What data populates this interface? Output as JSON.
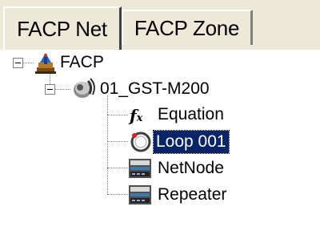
{
  "tabs": [
    {
      "label": "FACP Net",
      "active": true
    },
    {
      "label": "FACP Zone",
      "active": false
    }
  ],
  "tree": {
    "root": {
      "label": "FACP",
      "icon": "network-tower-icon",
      "expanded": true
    },
    "device": {
      "label": "01_GST-M200",
      "icon": "telephone-icon",
      "expanded": true
    },
    "children": [
      {
        "label": "Equation",
        "icon": "function-fx-icon",
        "selected": false
      },
      {
        "label": "Loop 001",
        "icon": "loop-ring-icon",
        "selected": true
      },
      {
        "label": "NetNode",
        "icon": "network-node-panel-icon",
        "selected": false
      },
      {
        "label": "Repeater",
        "icon": "repeater-panel-icon",
        "selected": false
      }
    ]
  },
  "colors": {
    "selection_bg": "#0a246a",
    "selection_text": "#ffffff",
    "tab_bg": "#ece9d8"
  }
}
